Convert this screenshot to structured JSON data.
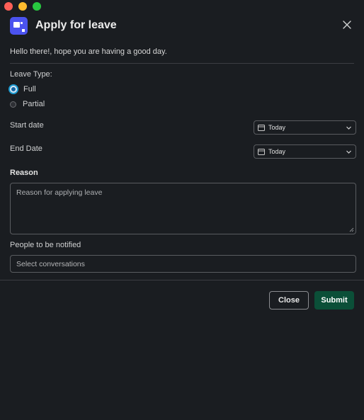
{
  "window": {
    "controls": [
      "close",
      "minimize",
      "zoom"
    ]
  },
  "header": {
    "title": "Apply for leave",
    "app_icon": "app-logo-icon",
    "close_icon": "close-icon"
  },
  "greeting": "Hello there!, hope you are having a good day.",
  "leave_type": {
    "label": "Leave Type:",
    "options": [
      {
        "label": "Full",
        "selected": true
      },
      {
        "label": "Partial",
        "selected": false
      }
    ]
  },
  "start_date": {
    "label": "Start date",
    "value": "Today"
  },
  "end_date": {
    "label": "End Date",
    "value": "Today"
  },
  "reason": {
    "label": "Reason",
    "placeholder": "Reason for applying leave"
  },
  "notify": {
    "label": "People to be notified",
    "placeholder": "Select conversations"
  },
  "actions": {
    "close_label": "Close",
    "submit_label": "Submit"
  },
  "colors": {
    "accent": "#1264a3",
    "submit_bg": "#0b4f38",
    "background": "#1a1d21",
    "logo": "#4b53f0"
  }
}
